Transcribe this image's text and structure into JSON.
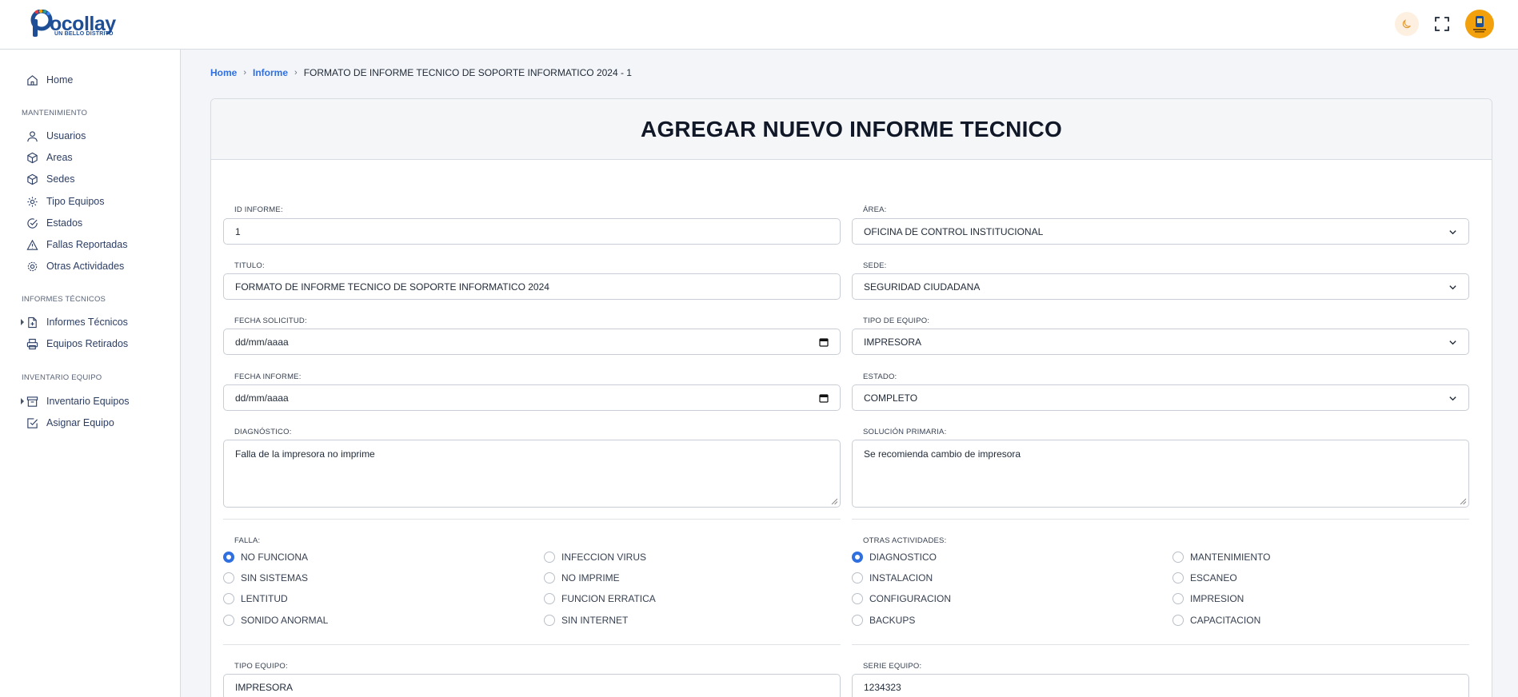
{
  "app": {
    "logo_text": "ocollay",
    "logo_tagline": "UN BELLO DISTRITO"
  },
  "colors": {
    "accent": "#2f6fe0",
    "avatar": "#f2a10c",
    "brand": "#1d4e96"
  },
  "sidebar": {
    "home": "Home",
    "sections": [
      "MANTENIMIENTO",
      "INFORMES TÉCNICOS",
      "INVENTARIO EQUIPO"
    ],
    "mantenimiento": [
      "Usuarios",
      "Areas",
      "Sedes",
      "Tipo Equipos",
      "Estados",
      "Fallas Reportadas",
      "Otras Actividades"
    ],
    "informes": [
      "Informes Técnicos",
      "Equipos Retirados"
    ],
    "inventario": [
      "Inventario Equipos",
      "Asignar Equipo"
    ]
  },
  "breadcrumb": {
    "home": "Home",
    "informe": "Informe",
    "current": "FORMATO DE INFORME TECNICO DE SOPORTE INFORMATICO 2024 - 1"
  },
  "form": {
    "title": "AGREGAR NUEVO INFORME TECNICO",
    "id_label": "ID INFORME:",
    "id_value": "1",
    "area_label": "ÁREA:",
    "area_value": "OFICINA DE CONTROL INSTITUCIONAL",
    "titulo_label": "TITULO:",
    "titulo_value": "FORMATO DE INFORME TECNICO DE SOPORTE INFORMATICO 2024",
    "sede_label": "SEDE:",
    "sede_value": "SEGURIDAD CIUDADANA",
    "fecha_sol_label": "FECHA SOLICITUD:",
    "fecha_sol_value": "dd/mm/aaaa",
    "tipo_label": "TIPO DE EQUIPO:",
    "tipo_value": "IMPRESORA",
    "fecha_inf_label": "FECHA INFORME:",
    "fecha_inf_value": "dd/mm/aaaa",
    "estado_label": "ESTADO:",
    "estado_value": "COMPLETO",
    "diag_label": "DIAGNÓSTICO:",
    "diag_value": "Falla de la impresora no imprime",
    "sol_label": "SOLUCIÓN PRIMARIA:",
    "sol_value": "Se recomienda cambio de impresora",
    "falla_label": "FALLA:",
    "fallas": [
      "NO FUNCIONA",
      "INFECCION VIRUS",
      "SIN SISTEMAS",
      "NO IMPRIME",
      "LENTITUD",
      "FUNCION ERRATICA",
      "SONIDO ANORMAL",
      "SIN INTERNET"
    ],
    "falla_selected": "NO FUNCIONA",
    "otras_label": "OTRAS ACTIVIDADES:",
    "otras": [
      "DIAGNOSTICO",
      "MANTENIMIENTO",
      "INSTALACION",
      "ESCANEO",
      "CONFIGURACION",
      "IMPRESION",
      "BACKUPS",
      "CAPACITACION"
    ],
    "otras_selected": "DIAGNOSTICO",
    "tipo_equipo_label": "TIPO EQUIPO:",
    "tipo_equipo_value": "IMPRESORA",
    "serie_label": "SERIE EQUIPO:",
    "serie_value": "1234323"
  }
}
